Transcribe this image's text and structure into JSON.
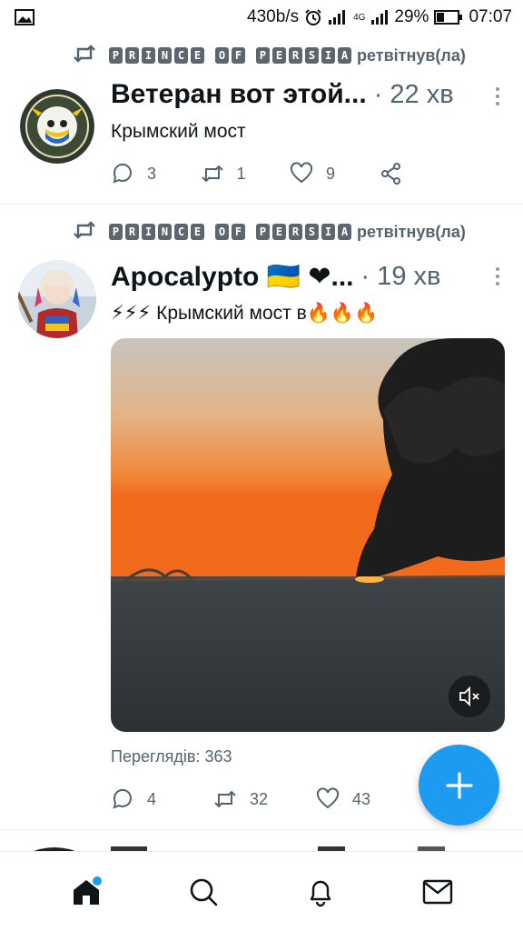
{
  "status_bar": {
    "speed": "430b/s",
    "battery": "29%",
    "time": "07:07",
    "network": "4G"
  },
  "tweets": [
    {
      "retweeted_by": "PRINCE OF PERSIA",
      "retweet_suffix": "ретвітнув(ла)",
      "display_name": "Ветеран вот этой...",
      "time": "· 22 хв",
      "text": "Крымский мост",
      "replies": "3",
      "retweets": "1",
      "likes": "9"
    },
    {
      "retweeted_by": "PRINCE OF PERSIA",
      "retweet_suffix": "ретвітнув(ла)",
      "display_name": "Apocalypto 🇺🇦 ❤...",
      "time": "· 19 хв",
      "text_prefix": "⚡⚡⚡",
      "text": " Крымский мост в",
      "text_suffix": "🔥🔥🔥",
      "views": "Переглядів: 363",
      "replies": "4",
      "retweets": "32",
      "likes": "43"
    }
  ],
  "colors": {
    "accent": "#1d9bf0",
    "muted": "#536471",
    "text": "#0f1419"
  },
  "icons": {
    "reply": "reply-icon",
    "retweet": "retweet-icon",
    "like": "heart-icon",
    "share": "share-icon",
    "home": "home-icon",
    "search": "search-icon",
    "notifications": "bell-icon",
    "messages": "mail-icon",
    "compose": "plus-icon"
  }
}
